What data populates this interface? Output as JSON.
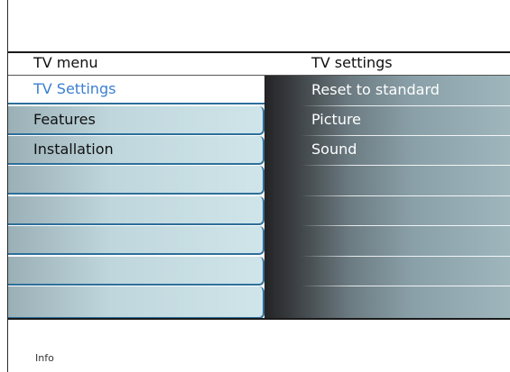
{
  "header": {
    "left_title": "TV menu",
    "right_title": "TV settings"
  },
  "left_menu": {
    "items": [
      {
        "label": "TV Settings",
        "selected": true
      },
      {
        "label": "Features",
        "selected": false
      },
      {
        "label": "Installation",
        "selected": false
      },
      {
        "label": "",
        "selected": false
      },
      {
        "label": "",
        "selected": false
      },
      {
        "label": "",
        "selected": false
      },
      {
        "label": "",
        "selected": false
      },
      {
        "label": "",
        "selected": false
      }
    ]
  },
  "right_menu": {
    "items": [
      {
        "label": "Reset to standard"
      },
      {
        "label": "Picture"
      },
      {
        "label": "Sound"
      },
      {
        "label": ""
      },
      {
        "label": ""
      },
      {
        "label": ""
      },
      {
        "label": ""
      },
      {
        "label": ""
      }
    ]
  },
  "footer": {
    "info_label": "Info"
  },
  "colors": {
    "selected_text": "#3b7fd0",
    "divider_blue": "#2d6f9a"
  }
}
